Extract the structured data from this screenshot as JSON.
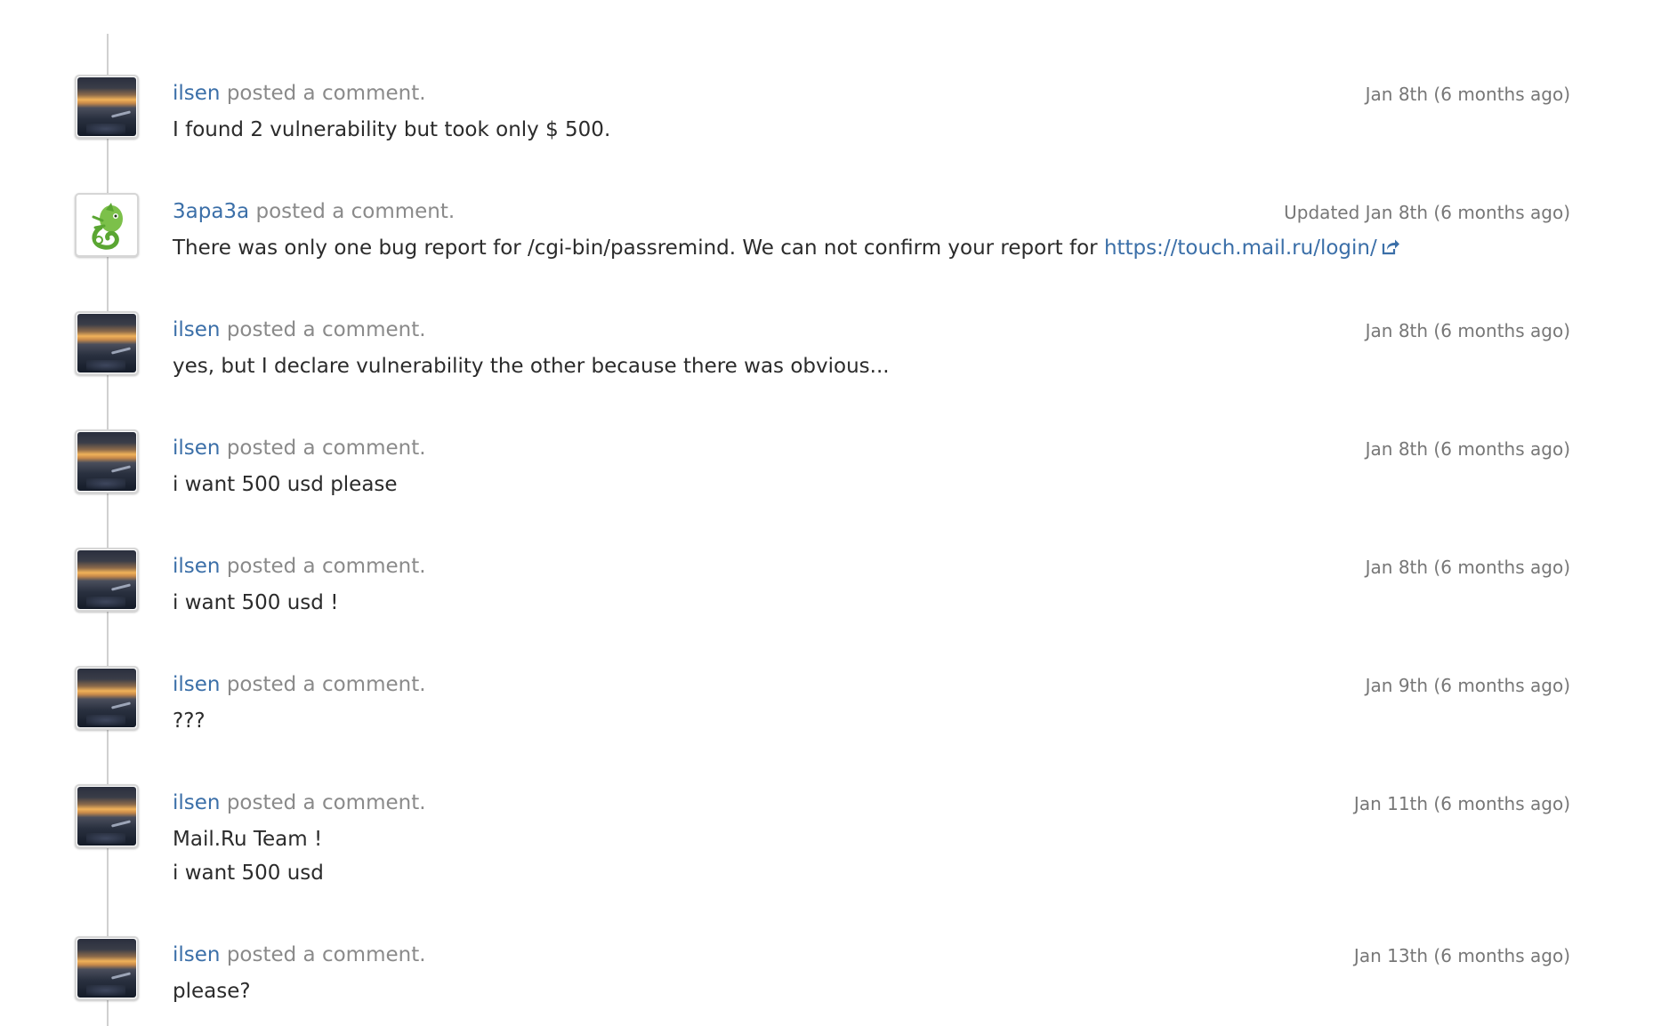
{
  "timeline": {
    "action_text": "posted a comment.",
    "comments": [
      {
        "author": "ilsen",
        "avatar": "sunset-photo",
        "timestamp": "Jan 8th (6 months ago)",
        "body": [
          "I found 2 vulnerability but took only $ 500."
        ]
      },
      {
        "author": "3apa3a",
        "avatar": "lizard-logo",
        "timestamp": "Updated Jan 8th (6 months ago)",
        "body_prefix": "There was only one bug report for /cgi-bin/passremind. We can not confirm your report for ",
        "link_text": "https://touch.mail.ru/login/",
        "link_icon": "external-link-icon"
      },
      {
        "author": "ilsen",
        "avatar": "sunset-photo",
        "timestamp": "Jan 8th (6 months ago)",
        "body": [
          "yes, but I declare vulnerability the other because there was obvious..."
        ]
      },
      {
        "author": "ilsen",
        "avatar": "sunset-photo",
        "timestamp": "Jan 8th (6 months ago)",
        "body": [
          "i want 500 usd please"
        ]
      },
      {
        "author": "ilsen",
        "avatar": "sunset-photo",
        "timestamp": "Jan 8th (6 months ago)",
        "body": [
          "i want 500 usd !"
        ]
      },
      {
        "author": "ilsen",
        "avatar": "sunset-photo",
        "timestamp": "Jan 9th (6 months ago)",
        "body": [
          "???"
        ]
      },
      {
        "author": "ilsen",
        "avatar": "sunset-photo",
        "timestamp": "Jan 11th (6 months ago)",
        "body": [
          "Mail.Ru Team !",
          "i want 500 usd"
        ]
      },
      {
        "author": "ilsen",
        "avatar": "sunset-photo",
        "timestamp": "Jan 13th (6 months ago)",
        "body": [
          "please?"
        ]
      }
    ]
  },
  "colors": {
    "link": "#3b6fa8",
    "meta_text": "#8a8a8a",
    "body_text": "#2b2b2b",
    "timeline_line": "#d0d0d0"
  }
}
